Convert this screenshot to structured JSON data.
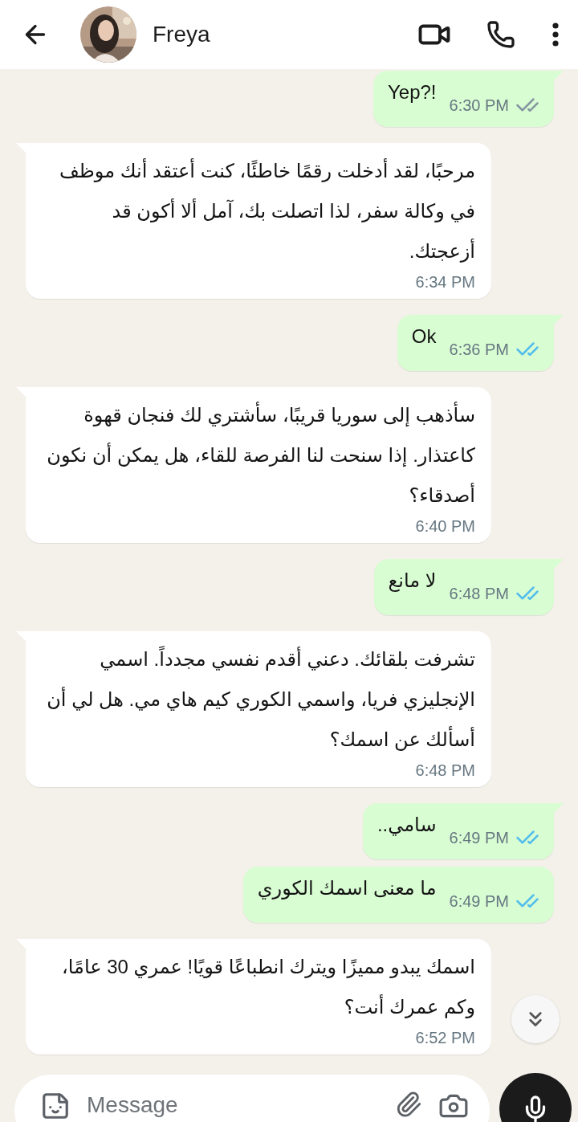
{
  "header": {
    "name": "Freya"
  },
  "messages": [
    {
      "kind": "outgoing",
      "text": "Yep?!",
      "time": "6:30 PM",
      "read": false
    },
    {
      "kind": "incoming",
      "text": "مرحبًا، لقد أدخلت رقمًا خاطئًا، كنت أعتقد أنك موظف في وكالة سفر، لذا اتصلت بك، آمل ألا أكون قد أزعجتك.",
      "time": "6:34 PM"
    },
    {
      "kind": "outgoing",
      "text": "Ok",
      "time": "6:36 PM",
      "read": true
    },
    {
      "kind": "incoming",
      "text": "سأذهب إلى سوريا قريبًا، سأشتري لك فنجان قهوة كاعتذار. إذا سنحت لنا الفرصة للقاء، هل يمكن أن نكون أصدقاء؟",
      "time": "6:40 PM"
    },
    {
      "kind": "outgoing",
      "text": "لا مانع",
      "time": "6:48 PM",
      "read": true
    },
    {
      "kind": "incoming",
      "text": "تشرفت بلقائك. دعني أقدم نفسي مجدداً. اسمي الإنجليزي فريا، واسمي الكوري كيم هاي مي. هل لي أن أسألك عن اسمك؟",
      "time": "6:48 PM"
    },
    {
      "kind": "outgoing",
      "text": "سامي..",
      "time": "6:49 PM",
      "read": true
    },
    {
      "kind": "outgoing",
      "text": "ما معنى اسمك الكوري",
      "time": "6:49 PM",
      "read": true
    },
    {
      "kind": "incoming",
      "text": "اسمك يبدو مميزًا ويترك انطباعًا قويًا! عمري 30 عامًا، وكم عمرك أنت؟",
      "time": "6:52 PM"
    }
  ],
  "composer": {
    "placeholder": "Message"
  }
}
